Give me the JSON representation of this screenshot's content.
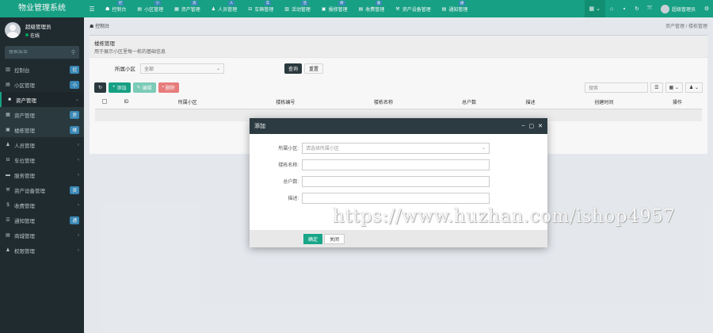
{
  "app": {
    "title": "物业管理系统"
  },
  "user": {
    "name": "超级管理员",
    "status": "在线"
  },
  "sidebar": {
    "search_placeholder": "搜索菜单",
    "items": [
      {
        "label": "控制台",
        "badge": "控",
        "badge_color": "#3c8dbc",
        "icon": "▥"
      },
      {
        "label": "小区管理",
        "badge": "小",
        "badge_color": "#3c8dbc",
        "icon": "▤"
      },
      {
        "label": "资产管理",
        "icon": "■",
        "chevron": "⌄"
      },
      {
        "label": "资产管理",
        "badge": "房",
        "badge_color": "#3c8dbc",
        "icon": "▦"
      },
      {
        "label": "楼栋管理",
        "badge": "楼",
        "badge_color": "#3c8dbc",
        "icon": "▣"
      },
      {
        "label": "人员管理",
        "icon": "♟",
        "chevron": "‹"
      },
      {
        "label": "车位管理",
        "icon": "⊟",
        "chevron": "‹"
      },
      {
        "label": "服务管理",
        "icon": "▬",
        "chevron": "‹"
      },
      {
        "label": "资产设备管理",
        "badge": "资",
        "badge_color": "#3c8dbc",
        "icon": "⚒"
      },
      {
        "label": "收费管理",
        "icon": "$",
        "chevron": "‹"
      },
      {
        "label": "通知管理",
        "badge": "通",
        "badge_color": "#3c8dbc",
        "icon": "☰"
      },
      {
        "label": "商城管理",
        "icon": "▤",
        "chevron": "‹"
      },
      {
        "label": "权限管理",
        "icon": "♟",
        "chevron": "‹"
      }
    ]
  },
  "topnav": {
    "tabs": [
      {
        "label": "控制台",
        "badge": "控",
        "icon": "☗"
      },
      {
        "label": "小区管理",
        "badge": "小",
        "icon": "▤"
      },
      {
        "label": "资产管理",
        "badge": "房",
        "icon": "▦"
      },
      {
        "label": "人员管理",
        "badge": "人",
        "icon": "♟"
      },
      {
        "label": "车辆管理",
        "badge": "车",
        "icon": "⊟"
      },
      {
        "label": "活动管理",
        "badge": "活",
        "icon": "▥"
      },
      {
        "label": "报修管理",
        "badge": "修",
        "icon": "▣"
      },
      {
        "label": "收费管理",
        "badge": "收",
        "icon": "▤"
      },
      {
        "label": "资产设备管理",
        "icon": "⚒"
      },
      {
        "label": "通知管理",
        "badge": "通",
        "icon": "▤"
      }
    ],
    "user_name": "超级管理员"
  },
  "breadcrumb": {
    "left": "控制台",
    "right": "资产管理 / 楼栋管理"
  },
  "panel": {
    "title": "楼栋管理",
    "subtitle": "用于展示小区里每一栋的基础信息",
    "filter_label": "所属小区",
    "filter_value": "全部",
    "query_button": "查询",
    "reset_button": "重置",
    "add_button": "添加",
    "edit_button": "编辑",
    "delete_button": "删除",
    "search_placeholder": "搜索",
    "columns": [
      "ID",
      "所属小区",
      "楼栋编号",
      "楼栋名称",
      "总户数",
      "描述",
      "创建时间",
      "操作"
    ]
  },
  "modal": {
    "title": "添加",
    "fields": [
      {
        "label": "所属小区:",
        "placeholder": "请选择所属小区",
        "type": "select"
      },
      {
        "label": "楼栋名称:",
        "placeholder": "",
        "type": "text"
      },
      {
        "label": "总户数:",
        "placeholder": "",
        "type": "text"
      },
      {
        "label": "描述:",
        "placeholder": "",
        "type": "text"
      }
    ],
    "ok_button": "确定",
    "cancel_button": "关闭"
  },
  "watermark": "https://www.huzhan.com/ishop4957",
  "colors": {
    "brand": "#18a689",
    "sidebar": "#222d32",
    "danger": "#f08080"
  }
}
